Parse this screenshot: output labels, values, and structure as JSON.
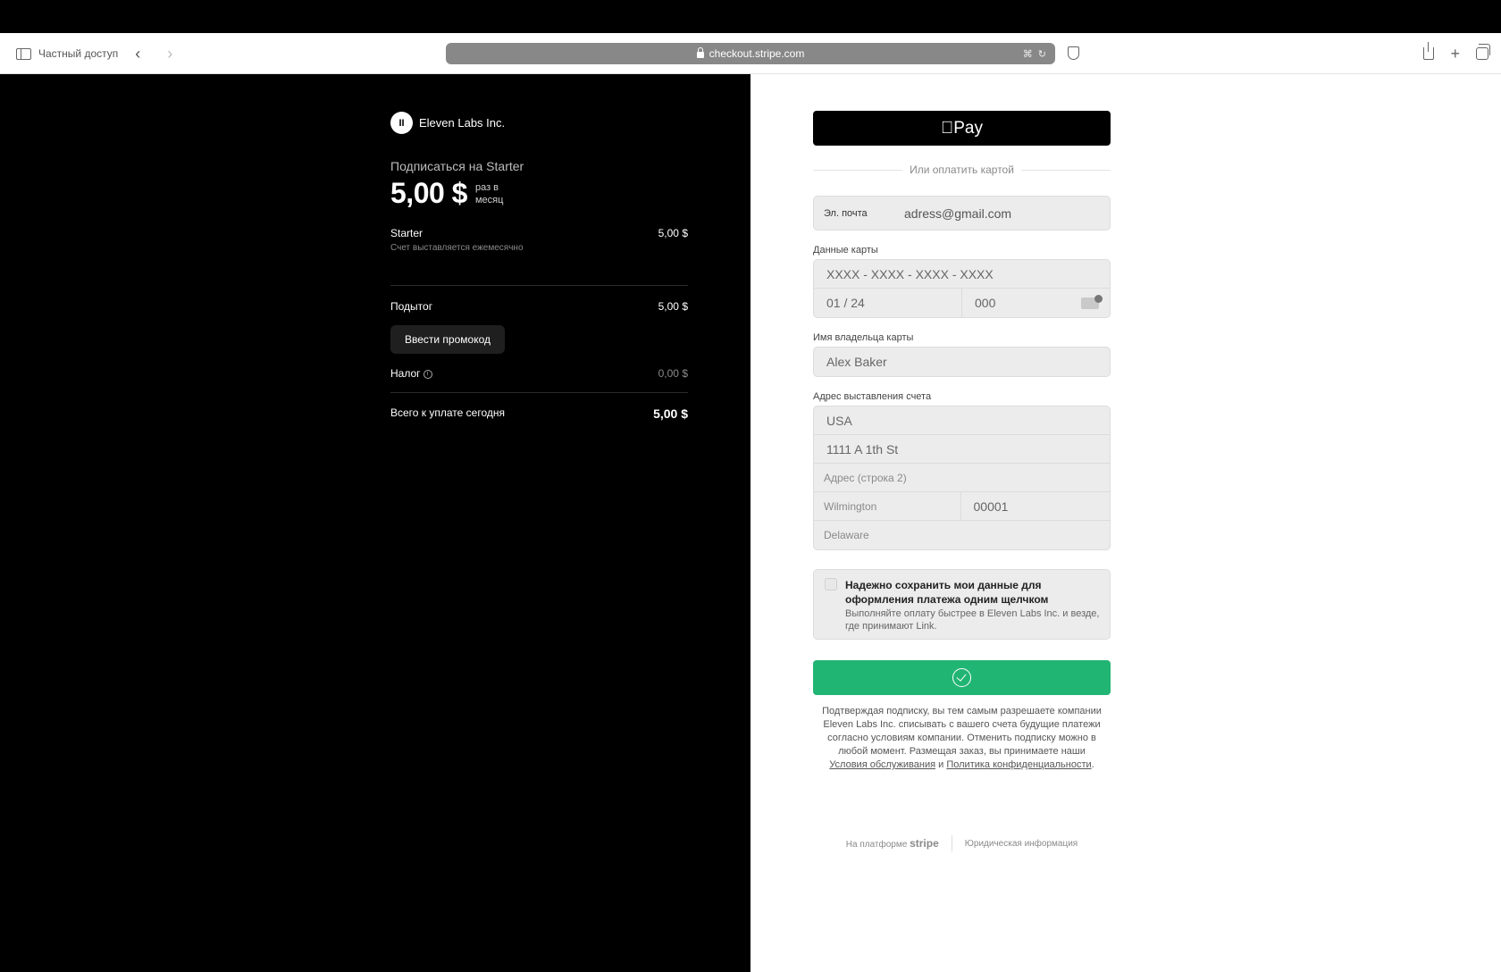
{
  "browser": {
    "private_label": "Частный доступ",
    "back_icon": "‹",
    "forward_icon": "›",
    "url": "checkout.stripe.com"
  },
  "summary": {
    "merchant": "Eleven Labs Inc.",
    "merchant_logo": "II",
    "subscribe_label": "Подписаться на Starter",
    "price": "5,00 $",
    "period_line1": "раз в",
    "period_line2": "месяц",
    "item_name": "Starter",
    "item_desc": "Счет выставляется ежемесячно",
    "item_price": "5,00 $",
    "subtotal_label": "Подытог",
    "subtotal_value": "5,00 $",
    "promo_label": "Ввести промокод",
    "tax_label": "Налог",
    "tax_value": "0,00 $",
    "total_label": "Всего к уплате сегодня",
    "total_value": "5,00 $"
  },
  "form": {
    "applepay_label": " Pay",
    "or_label": "Или оплатить картой",
    "email_label": "Эл. почта",
    "email_value": "adress@gmail.com",
    "card_label": "Данные карты",
    "card_number": "XXXX - XXXX - XXXX - XXXX",
    "card_expiry": "01 / 24",
    "card_cvc": "000",
    "holder_label": "Имя владельца карты",
    "holder_value": "Alex Baker",
    "address_label": "Адрес выставления счета",
    "country": "USA",
    "address_line1": "1111 A 1th St",
    "address_line2": "Адрес (строка 2)",
    "city": "Wilmington",
    "zip": "00001",
    "state": "Delaware",
    "save_title": "Надежно сохранить мои данные для оформления платежа одним щелчком",
    "save_desc": "Выполняйте оплату быстрее в Eleven Labs Inc. и везде, где принимают Link.",
    "legal_text": "Подтверждая подписку, вы тем самым разрешаете компании Eleven Labs Inc. списывать с вашего счета будущие платежи согласно условиям компании. Отменить подписку можно в любой момент. Размещая заказ, вы принимаете наши",
    "terms_link": "Условия обслуживания",
    "and": "и",
    "privacy_link": "Политика конфиденциальности",
    "period": ".",
    "powered_by": "На платформе",
    "stripe_word": "stripe",
    "legal_info": "Юридическая информация",
    "pay_color": "#21b574"
  }
}
